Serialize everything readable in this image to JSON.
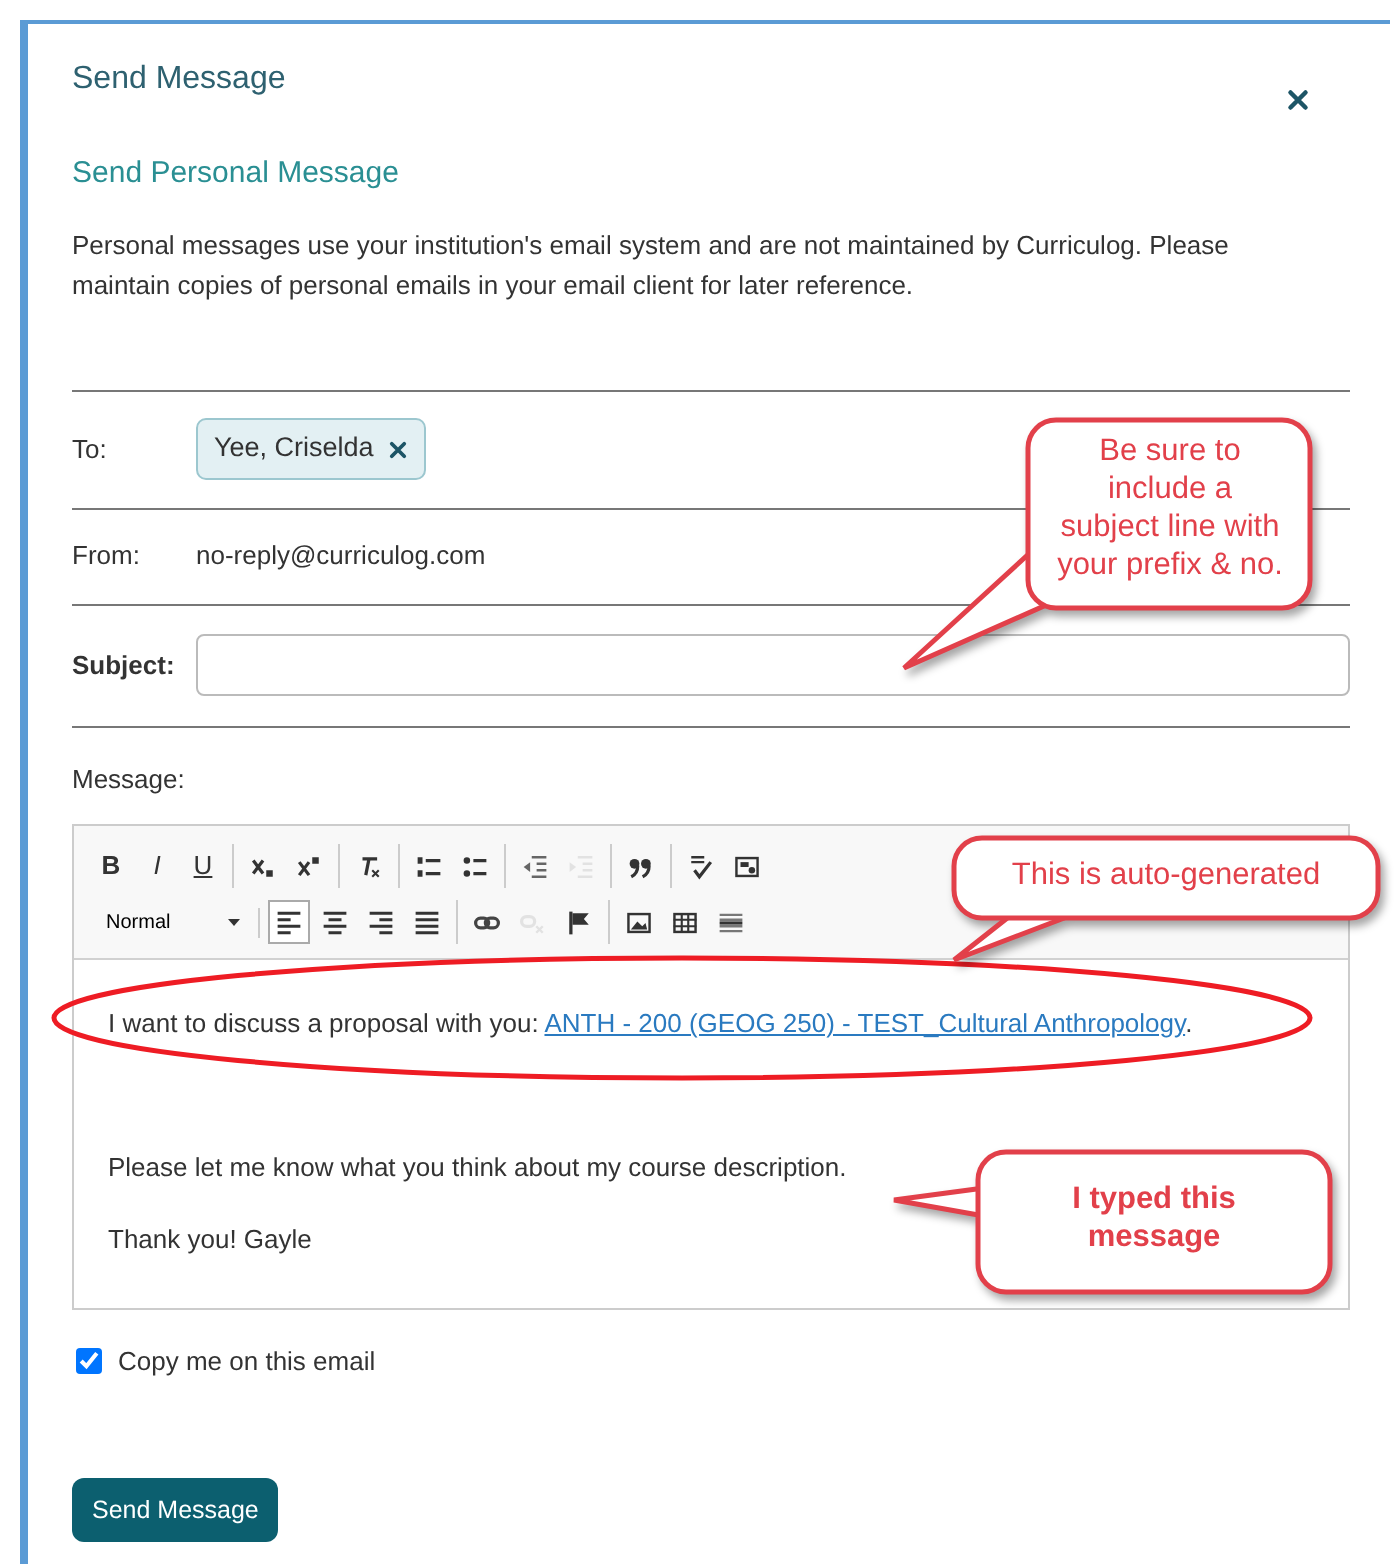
{
  "dialog": {
    "title": "Send Message",
    "subtitle": "Send Personal Message",
    "notice": "Personal messages use your institution's email system and are not maintained by Curriculog. Please maintain copies of personal emails in your email client for later reference."
  },
  "to": {
    "label": "To:",
    "recipients": [
      {
        "name": "Yee, Criselda"
      }
    ]
  },
  "from": {
    "label": "From:",
    "value": "no-reply@curriculog.com"
  },
  "subject": {
    "label": "Subject:"
  },
  "message": {
    "label": "Message:",
    "toolbar": [
      [
        [
          {
            "kind": "glyph",
            "label": "B"
          },
          {
            "kind": "glyph",
            "label": "I"
          },
          {
            "kind": "glyph",
            "label": "U"
          }
        ],
        [
          {
            "kind": "icon",
            "disabled": false
          },
          {
            "kind": "icon",
            "disabled": false
          }
        ],
        [
          {
            "kind": "icon",
            "disabled": false
          }
        ],
        [
          {
            "kind": "icon",
            "disabled": false
          },
          {
            "kind": "icon",
            "disabled": false
          }
        ],
        [
          {
            "kind": "icon",
            "disabled": false
          },
          {
            "kind": "icon",
            "disabled": true
          }
        ],
        [
          {
            "kind": "icon",
            "disabled": false
          }
        ],
        [
          {
            "kind": "icon",
            "disabled": false
          },
          {
            "kind": "icon",
            "disabled": false
          }
        ]
      ],
      [
        [
          {
            "kind": "dropdown",
            "label": "Normal"
          }
        ],
        [
          {
            "kind": "icon",
            "disabled": false,
            "selected": true
          },
          {
            "kind": "icon",
            "disabled": false,
            "selected": false
          },
          {
            "kind": "icon",
            "disabled": false,
            "selected": false
          },
          {
            "kind": "icon",
            "disabled": false,
            "selected": false
          }
        ],
        [
          {
            "kind": "icon",
            "disabled": false
          },
          {
            "kind": "icon",
            "disabled": true
          },
          {
            "kind": "icon",
            "disabled": false
          }
        ],
        [
          {
            "kind": "icon",
            "disabled": false
          },
          {
            "kind": "icon",
            "disabled": false
          },
          {
            "kind": "icon",
            "disabled": false
          }
        ]
      ]
    ],
    "body": [
      {
        "kind": "link_line",
        "text": "I want to discuss a proposal with you: ",
        "link": "ANTH - 200 (GEOG 250) - TEST_Cultural Anthropology",
        "after": "."
      },
      {
        "kind": "blank"
      },
      {
        "kind": "text",
        "text": "Please let me know what you think about my course description."
      },
      {
        "kind": "text",
        "text": "Thank you! Gayle"
      }
    ]
  },
  "copy_me": {
    "label": "Copy me on this email",
    "checked": true
  },
  "send_button": "Send Message",
  "annotations": [
    {
      "text": "Be sure to include a subject line with your prefix & no.",
      "bold": false
    },
    {
      "text": "This is auto-generated",
      "bold": false
    },
    {
      "text": "I typed this message",
      "bold": true
    }
  ]
}
